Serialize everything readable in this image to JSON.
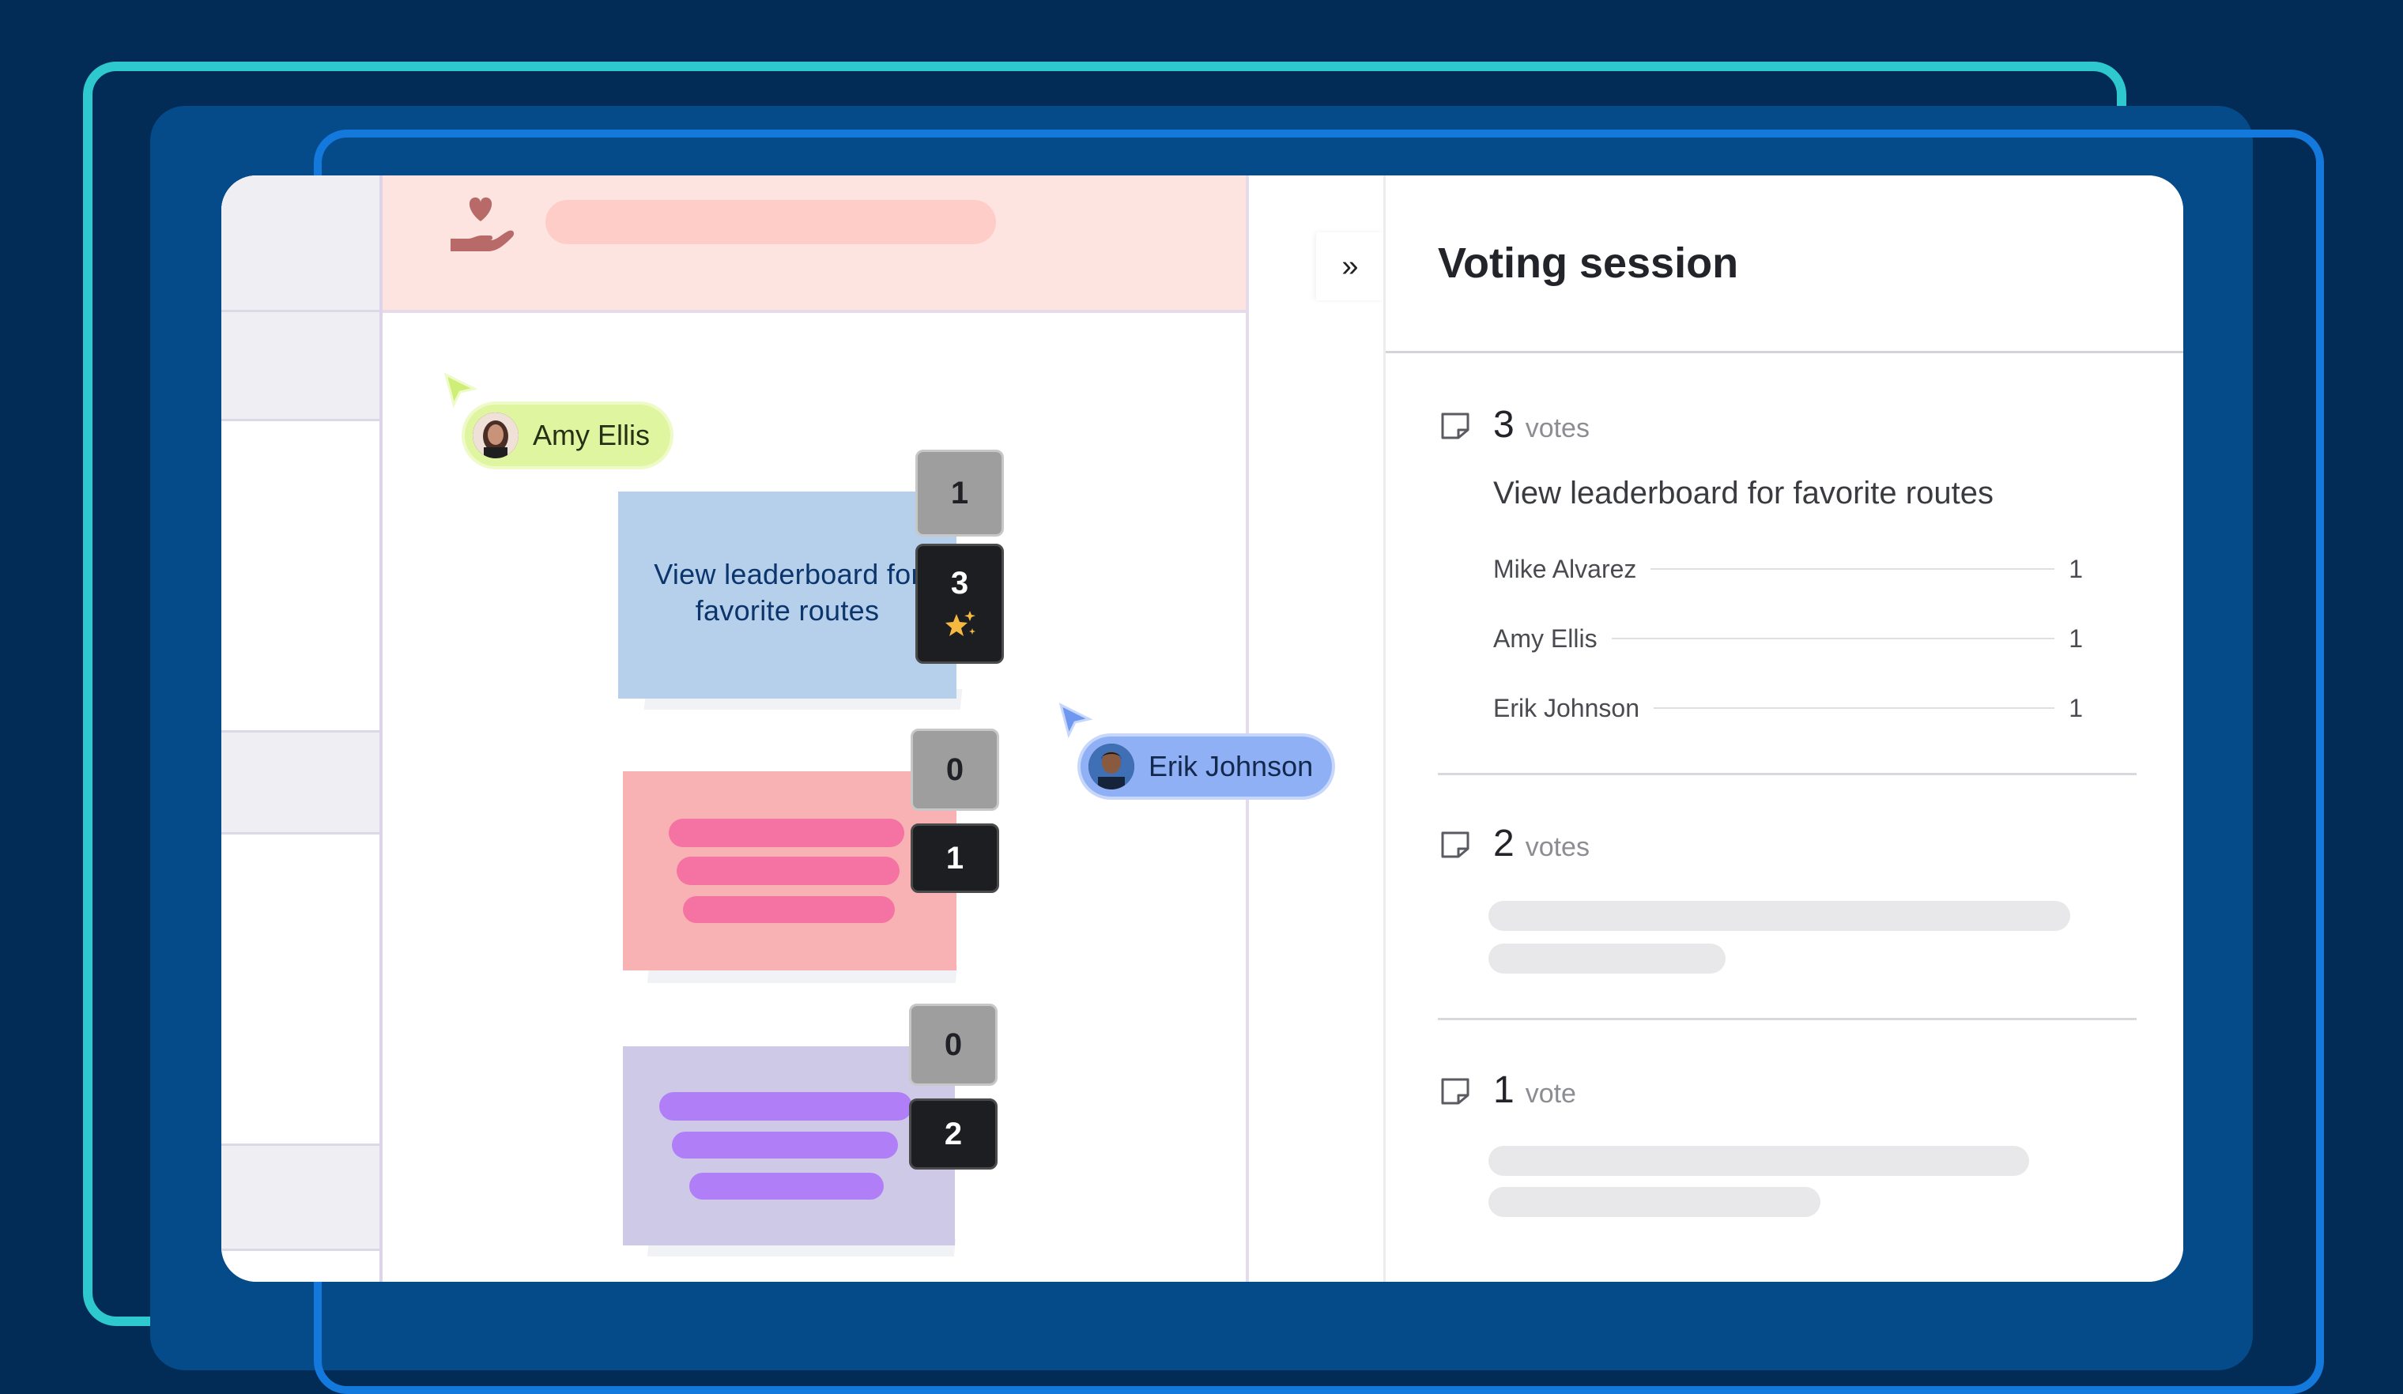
{
  "board": {
    "cursors": [
      {
        "user": "Amy Ellis",
        "color": "#dff59f"
      },
      {
        "user": "Erik Johnson",
        "color": "#8fb0f5"
      }
    ],
    "sticky_notes": [
      {
        "text": "View leaderboard for favorite routes",
        "color": "#b6d0ec",
        "badge_top": "1",
        "badge_bottom": "3",
        "starred": true
      },
      {
        "text": "",
        "color": "#f8b2b3",
        "badge_top": "0",
        "badge_bottom": "1"
      },
      {
        "text": "",
        "color": "#cec9e6",
        "badge_top": "0",
        "badge_bottom": "2"
      }
    ]
  },
  "panel": {
    "collapse_icon": "»",
    "title": "Voting session",
    "groups": [
      {
        "votes": "3",
        "vote_word": "votes",
        "title": "View leaderboard for favorite routes",
        "voters": [
          {
            "name": "Mike Alvarez",
            "count": "1"
          },
          {
            "name": "Amy Ellis",
            "count": "1"
          },
          {
            "name": "Erik Johnson",
            "count": "1"
          }
        ]
      },
      {
        "votes": "2",
        "vote_word": "votes"
      },
      {
        "votes": "1",
        "vote_word": "vote"
      }
    ]
  },
  "colors": {
    "background": "#022c56",
    "frame_teal": "#2ec9cf",
    "frame_blue": "#1479dc",
    "header_pink": "#fde4e1"
  }
}
